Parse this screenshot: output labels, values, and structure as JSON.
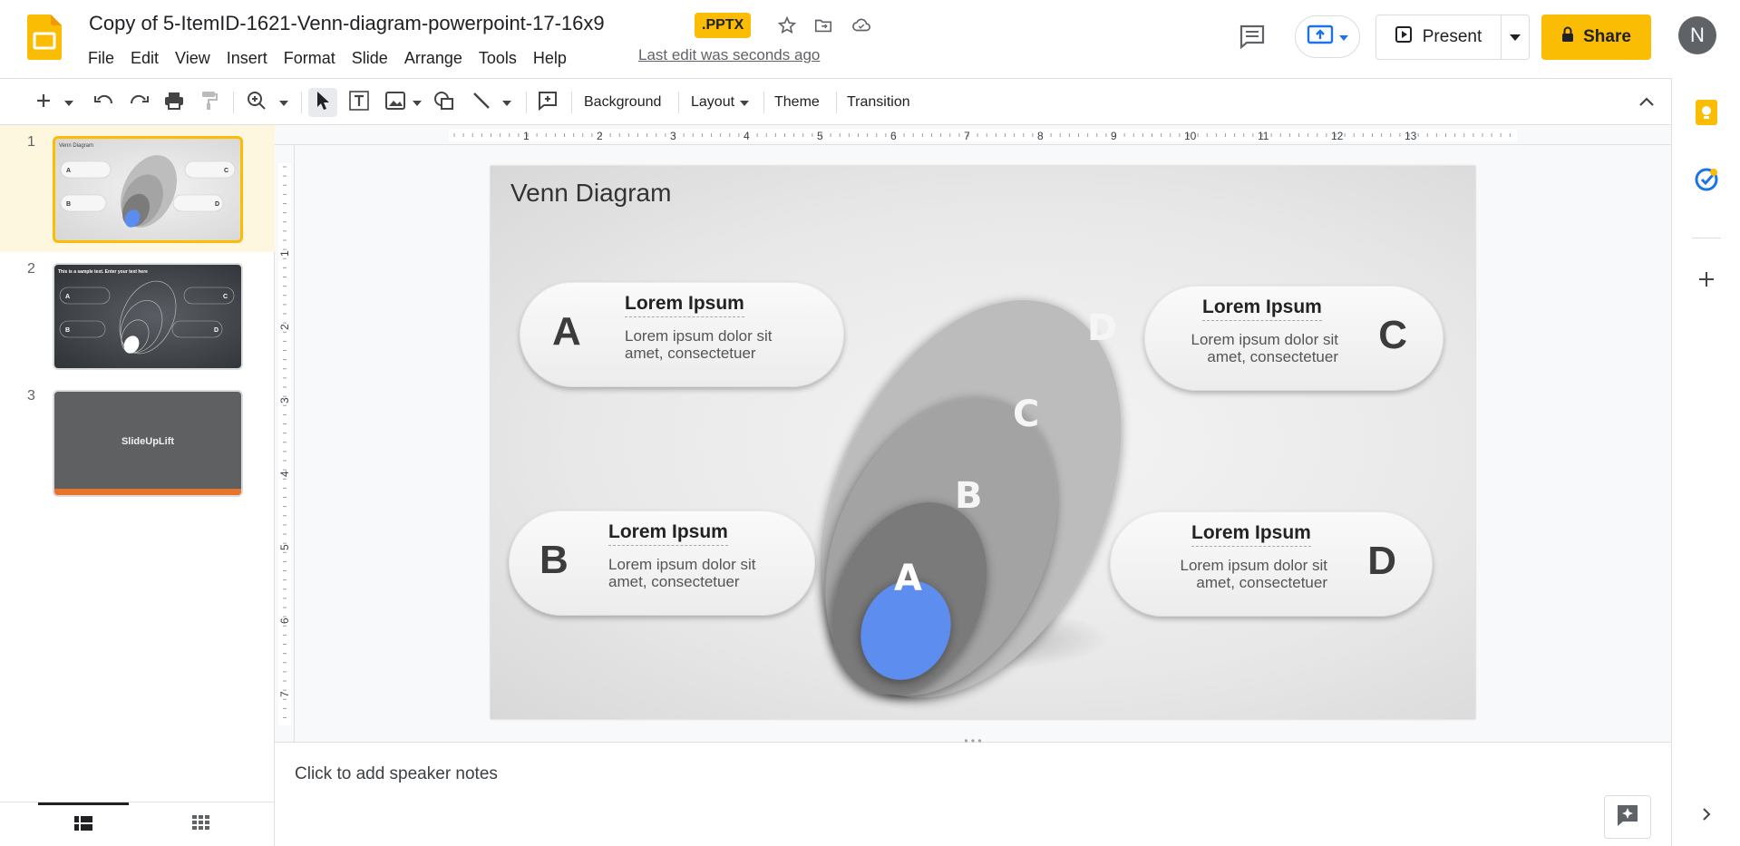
{
  "app": {
    "doc_title": "Copy of 5-ItemID-1621-Venn-diagram-powerpoint-17-16x9",
    "file_badge": ".PPTX",
    "last_edit": "Last edit was seconds ago",
    "avatar_initial": "N",
    "present_label": "Present",
    "share_label": "Share",
    "brand_color": "#fbbc04",
    "accent_blue": "#1a73e8"
  },
  "menu": [
    "File",
    "Edit",
    "View",
    "Insert",
    "Format",
    "Slide",
    "Arrange",
    "Tools",
    "Help"
  ],
  "toolbar": {
    "background": "Background",
    "layout": "Layout",
    "theme": "Theme",
    "transition": "Transition"
  },
  "ruler": {
    "h_marks": [
      "1",
      "2",
      "3",
      "4",
      "5",
      "6",
      "7",
      "8",
      "9",
      "10",
      "11",
      "12",
      "13"
    ],
    "v_marks": [
      "1",
      "2",
      "3",
      "4",
      "5",
      "6",
      "7"
    ]
  },
  "slides": [
    {
      "number": "1",
      "title": "Venn Diagram",
      "selected": true
    },
    {
      "number": "2",
      "title": "This is a sample text. Enter your text here"
    },
    {
      "number": "3",
      "title": "SlideUpLift"
    }
  ],
  "slide": {
    "title": "Venn Diagram",
    "ellipse_labels": {
      "a": "A",
      "b": "B",
      "c": "C",
      "d": "D"
    },
    "cards": [
      {
        "letter": "A",
        "heading": "Lorem Ipsum",
        "body": "Lorem ipsum dolor sit amet, consectetuer"
      },
      {
        "letter": "C",
        "heading": "Lorem Ipsum",
        "body": "Lorem ipsum dolor sit amet, consectetuer"
      },
      {
        "letter": "B",
        "heading": "Lorem Ipsum",
        "body": "Lorem ipsum dolor sit amet, consectetuer"
      },
      {
        "letter": "D",
        "heading": "Lorem Ipsum",
        "body": "Lorem ipsum dolor sit amet, consectetuer"
      }
    ],
    "colors": {
      "ellipse_a": "#5b8def",
      "ellipse_b": "#7a7a7a",
      "ellipse_c": "#a3a3a3",
      "ellipse_d": "#bcbcbc"
    }
  },
  "notes": {
    "placeholder": "Click to add speaker notes"
  },
  "icons": {
    "header": [
      "star-icon",
      "move-to-folder-icon",
      "cloud-saved-icon",
      "comment-history-icon",
      "meet-present-icon",
      "present-icon",
      "lock-icon"
    ],
    "toolbar": [
      "new-slide-icon",
      "undo-icon",
      "redo-icon",
      "print-icon",
      "paint-format-icon",
      "zoom-icon",
      "select-icon",
      "text-box-icon",
      "image-icon",
      "shape-icon",
      "line-icon",
      "comment-add-icon",
      "collapse-icon"
    ],
    "side": [
      "keep-icon",
      "tasks-icon",
      "add-icon",
      "expand-panel-icon"
    ]
  }
}
